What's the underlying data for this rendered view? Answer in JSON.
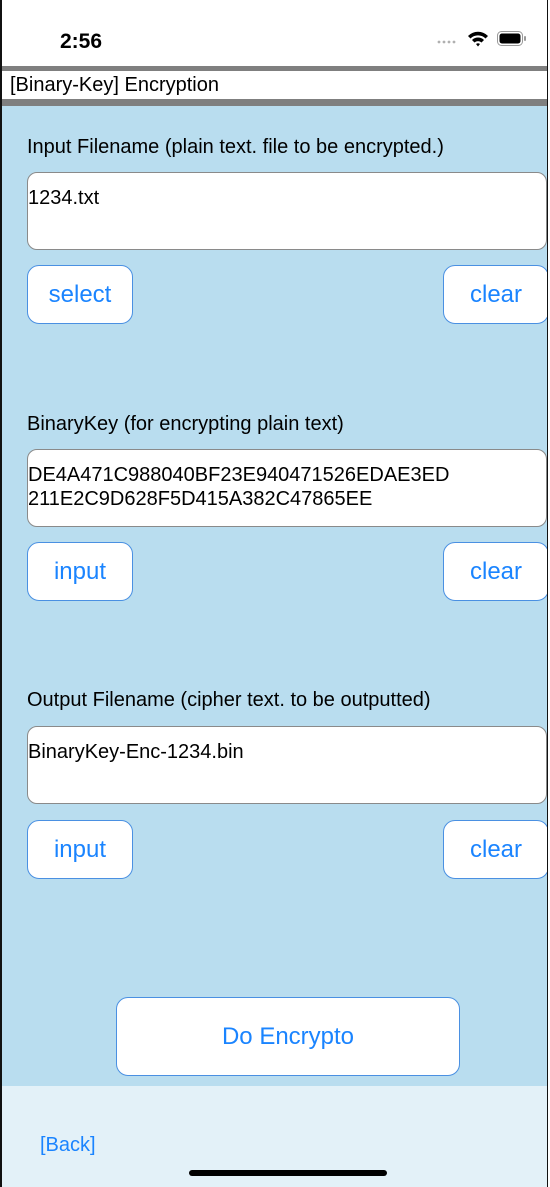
{
  "status_bar": {
    "time": "2:56",
    "icons": [
      "signal-icon",
      "wifi-icon",
      "battery-icon"
    ]
  },
  "header": {
    "title": "[Binary-Key] Encryption"
  },
  "input_section": {
    "label": "Input Filename (plain text. file to be encrypted.)",
    "value": "1234.txt",
    "select_label": "select",
    "clear_label": "clear"
  },
  "key_section": {
    "label": "BinaryKey (for encrypting plain text)",
    "value_line1": "DE4A471C988040BF23E940471526EDAE3ED",
    "value_line2": "211E2C9D628F5D415A382C47865EE",
    "input_label": "input",
    "clear_label": "clear"
  },
  "output_section": {
    "label": "Output Filename (cipher text. to be outputted)",
    "value": "BinaryKey-Enc-1234.bin",
    "input_label": "input",
    "clear_label": "clear"
  },
  "action": {
    "encrypt_label": "Do Encrypto"
  },
  "footer": {
    "back_label": "[Back]"
  },
  "colors": {
    "content_bg": "#b9ddef",
    "footer_bg": "#e3f1f8",
    "accent": "#1a84ff",
    "separator": "#7f7f7f"
  }
}
